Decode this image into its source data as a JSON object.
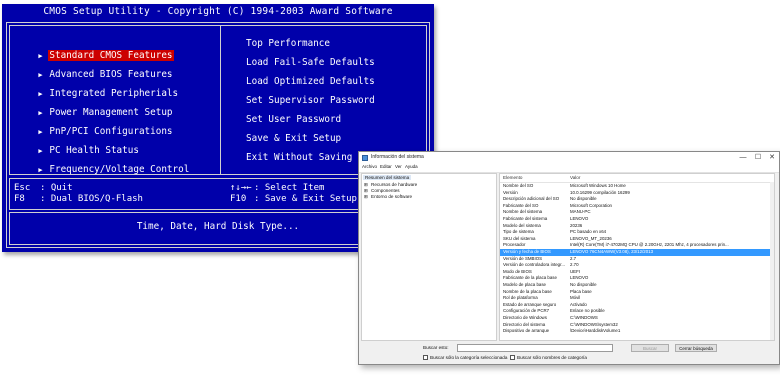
{
  "bios": {
    "title": "CMOS Setup Utility - Copyright (C) 1994-2003 Award Software",
    "left_menu": [
      {
        "label": "Standard CMOS Features",
        "selected": true
      },
      {
        "label": "Advanced BIOS Features",
        "selected": false
      },
      {
        "label": "Integrated Peripherials",
        "selected": false
      },
      {
        "label": "Power Management Setup",
        "selected": false
      },
      {
        "label": "PnP/PCI Configurations",
        "selected": false
      },
      {
        "label": "PC Health Status",
        "selected": false
      },
      {
        "label": "Frequency/Voltage Control",
        "selected": false
      }
    ],
    "right_menu": [
      "Top Performance",
      "Load Fail-Safe Defaults",
      "Load Optimized Defaults",
      "Set Supervisor Password",
      "Set User Password",
      "Save & Exit Setup",
      "Exit Without Saving"
    ],
    "keys": {
      "esc_key": "Esc",
      "esc_action": ": Quit",
      "f8_key": "F8",
      "f8_action": ": Dual BIOS/Q-Flash",
      "arrows": "↑↓→←",
      "arrows_action": ": Select Item",
      "f10_key": "F10",
      "f10_action": ": Save & Exit Setup"
    },
    "help": "Time, Date, Hard Disk Type..."
  },
  "sysinfo": {
    "window_title": "Información del sistema",
    "window_buttons": {
      "minimize": "—",
      "maximize": "☐",
      "close": "✕"
    },
    "menu": [
      "Archivo",
      "Editar",
      "Ver",
      "Ayuda"
    ],
    "tree": {
      "root": "Resumen del sistema",
      "children": [
        "Recursos de hardware",
        "Componentes",
        "Entorno de software"
      ]
    },
    "columns": [
      "Elemento",
      "Valor"
    ],
    "rows": [
      {
        "item": "Nombre del SO",
        "value": "Microsoft Windows 10 Home",
        "selected": false
      },
      {
        "item": "Versión",
        "value": "10.0.16299 compilación 16299",
        "selected": false
      },
      {
        "item": "Descripción adicional del SO",
        "value": "No disponible",
        "selected": false
      },
      {
        "item": "Fabricante del SO",
        "value": "Microsoft Corporation",
        "selected": false
      },
      {
        "item": "Nombre del sistema",
        "value": "MANU-PC",
        "selected": false
      },
      {
        "item": "Fabricante del sistema",
        "value": "LENOVO",
        "selected": false
      },
      {
        "item": "Modelo del sistema",
        "value": "20236",
        "selected": false
      },
      {
        "item": "Tipo de sistema",
        "value": "PC basado en x64",
        "selected": false
      },
      {
        "item": "SKU del sistema",
        "value": "LENOVO_MT_20236",
        "selected": false
      },
      {
        "item": "Procesador",
        "value": "Intel(R) Core(TM) i7-4702MQ CPU @ 2.20GHz, 2201 Mhz, 4 procesadores prin...",
        "selected": false
      },
      {
        "item": "Versión y fecha de BIOS",
        "value": "LENOVO 76CN4AWW(V3.08), 23/12/2013",
        "selected": true
      },
      {
        "item": "Versión de SMBIOS",
        "value": "2.7",
        "selected": false
      },
      {
        "item": "Versión de controladora integr...",
        "value": "2.70",
        "selected": false
      },
      {
        "item": "Modo de BIOS",
        "value": "UEFI",
        "selected": false
      },
      {
        "item": "Fabricante de la placa base",
        "value": "LENOVO",
        "selected": false
      },
      {
        "item": "Modelo de placa base",
        "value": "No disponible",
        "selected": false
      },
      {
        "item": "Nombre de la placa base",
        "value": "Placa base",
        "selected": false
      },
      {
        "item": "Rol de plataforma",
        "value": "Móvil",
        "selected": false
      },
      {
        "item": "Estado de arranque seguro",
        "value": "Activado",
        "selected": false
      },
      {
        "item": "Configuración de PCR7",
        "value": "Enlace no posible",
        "selected": false
      },
      {
        "item": "Directorio de Windows",
        "value": "C:\\WINDOWS",
        "selected": false
      },
      {
        "item": "Directorio del sistema",
        "value": "C:\\WINDOWS\\system32",
        "selected": false
      },
      {
        "item": "Dispositivo de arranque",
        "value": "\\Device\\HarddiskVolume1",
        "selected": false
      }
    ],
    "search": {
      "label": "Buscar esto:",
      "value": "",
      "search_button": "Buscar",
      "close_button": "Cerrar búsqueda",
      "checkbox_category": "Buscar sólo la categoría seleccionada",
      "checkbox_names": "Buscar sólo nombres de categoría"
    }
  }
}
